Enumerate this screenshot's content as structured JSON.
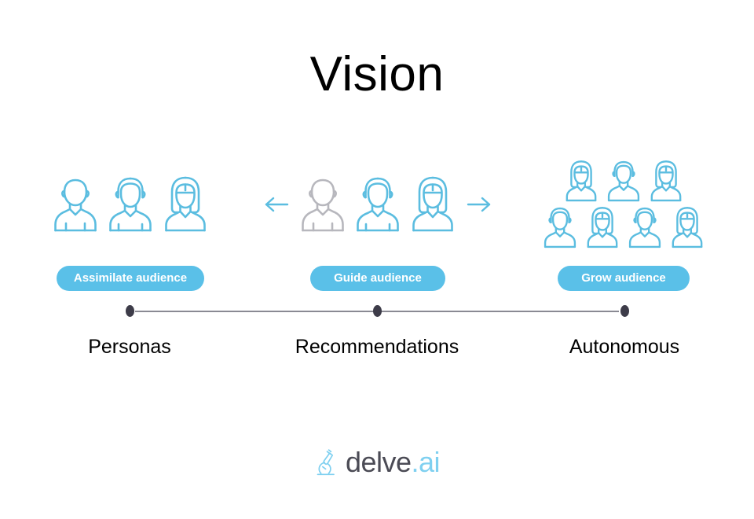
{
  "page": {
    "title": "Vision",
    "background_color": "#ffffff"
  },
  "theme": {
    "accent_blue": "#5ac0e8",
    "icon_blue": "#5bbde0",
    "icon_grey": "#b7b7bd",
    "timeline_dot": "#3d3c49",
    "timeline_line": "#8a8a93",
    "caption_color": "#000000"
  },
  "stages": [
    {
      "id": "personas",
      "badge_label": "Assimilate audience",
      "caption": "Personas",
      "icon_count": 3,
      "icon_kinds": [
        "person-plain-icon",
        "person-male-icon",
        "person-female-icon"
      ],
      "has_arrows": false
    },
    {
      "id": "recommendations",
      "badge_label": "Guide audience",
      "caption": "Recommendations",
      "icon_count": 3,
      "icon_kinds": [
        "person-plain-grey-icon",
        "person-male-icon",
        "person-female-icon"
      ],
      "has_arrows": true,
      "arrow_left": "arrow-left-icon",
      "arrow_right": "arrow-right-icon"
    },
    {
      "id": "autonomous",
      "badge_label": "Grow audience",
      "caption": "Autonomous",
      "icon_count": 7,
      "icon_rows": [
        [
          "person-female-icon",
          "person-male-icon",
          "person-female-icon"
        ],
        [
          "person-male-icon",
          "person-female-icon",
          "person-male-icon",
          "person-female-icon"
        ]
      ],
      "has_arrows": false
    }
  ],
  "timeline": {
    "dot_count": 3,
    "dots": [
      "Personas",
      "Recommendations",
      "Autonomous"
    ]
  },
  "footer": {
    "logo_icon": "microscope-icon",
    "logo_name": "delve",
    "logo_suffix": ".ai"
  }
}
